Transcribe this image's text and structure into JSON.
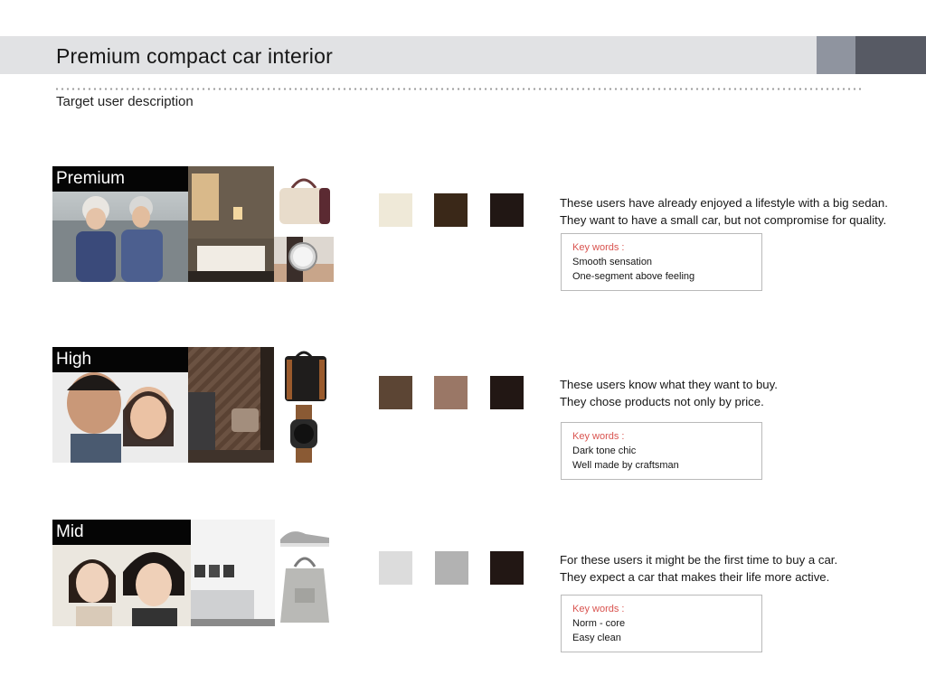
{
  "header": {
    "title": "Premium compact car interior",
    "accent_light": "#8f949f",
    "accent_dark": "#575a64"
  },
  "subtitle": "Target user description",
  "keywords_label": "Key words :",
  "segments": [
    {
      "label": "Premium",
      "swatches": [
        "#efe9d8",
        "#3a2818",
        "#211714"
      ],
      "description": [
        "These users have already enjoyed a lifestyle with a big sedan.",
        "They want to have a small car, but not compromise for quality."
      ],
      "keywords": [
        "Smooth sensation",
        "One-segment above feeling"
      ]
    },
    {
      "label": "High",
      "swatches": [
        "#5c4534",
        "#9a7766",
        "#221714"
      ],
      "description": [
        "These users know what they want to buy.",
        "They chose products not only by price."
      ],
      "keywords": [
        "Dark tone chic",
        "Well made by craftsman"
      ]
    },
    {
      "label": "Mid",
      "swatches": [
        "#dcdcdc",
        "#b2b2b2",
        "#221714"
      ],
      "description": [
        "For these users it might be the first time to buy a car.",
        "They expect a car that makes their life more active."
      ],
      "keywords": [
        "Norm - core",
        "Easy clean"
      ]
    }
  ]
}
